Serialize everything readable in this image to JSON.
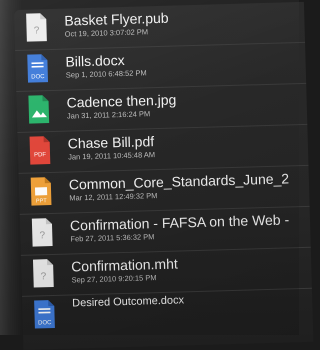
{
  "files": [
    {
      "name": "Basket Flyer.pub",
      "date": "Oct 19, 2010 3:07:02 PM",
      "icon": "unknown-file-icon",
      "color": "#e9e9e9"
    },
    {
      "name": "Bills.docx",
      "date": "Sep 1, 2010 6:48:52 PM",
      "icon": "word-document-icon",
      "color": "#3f7bd9"
    },
    {
      "name": "Cadence then.jpg",
      "date": "Jan 31, 2011 2:16:24 PM",
      "icon": "image-file-icon",
      "color": "#29b36a"
    },
    {
      "name": "Chase Bill.pdf",
      "date": "Jan 19, 2011 10:45:48 AM",
      "icon": "pdf-file-icon",
      "color": "#e0463a"
    },
    {
      "name": "Common_Core_Standards_June_2",
      "date": "Mar 12, 2011 12:49:32 PM",
      "icon": "presentation-file-icon",
      "color": "#f0a23a"
    },
    {
      "name": "Confirmation - FAFSA on the Web -",
      "date": "Feb 27, 2011 5:36:32 PM",
      "icon": "unknown-file-icon",
      "color": "#e9e9e9"
    },
    {
      "name": "Confirmation.mht",
      "date": "Sep 27, 2010 9:20:15 PM",
      "icon": "unknown-file-icon",
      "color": "#e9e9e9"
    },
    {
      "name": "Desired Outcome.docx",
      "date": "",
      "icon": "word-document-icon",
      "color": "#3f7bd9"
    }
  ]
}
